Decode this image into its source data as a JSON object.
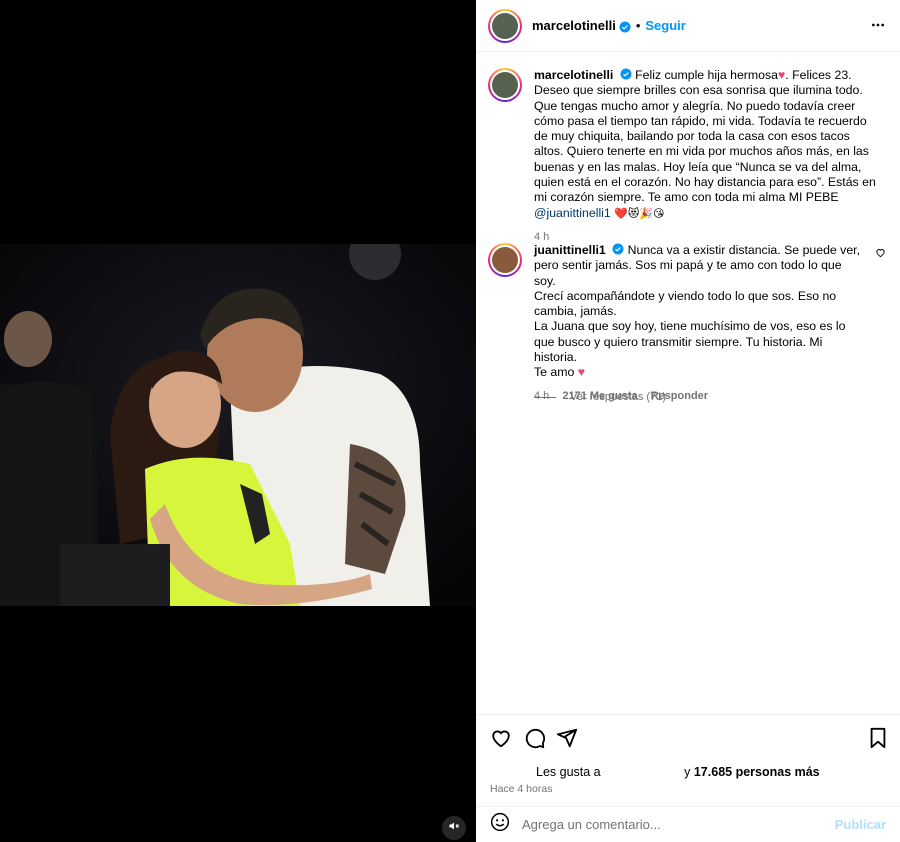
{
  "post": {
    "author": "marcelotinelli",
    "follow_label": "Seguir",
    "separator": "•"
  },
  "caption": {
    "username": "marcelotinelli",
    "text_1": "Feliz cumple hija hermosa",
    "text_2": ". Felices 23. Deseo que siempre brilles con esa sonrisa que ilumina todo. Que tengas mucho amor y alegría. No puedo todavía creer cómo pasa el tiempo tan rápido, mi vida. Todavía te recuerdo de muy chiquita, bailando por toda la casa con esos tacos altos. Quiero tenerte en mi vida por muchos años más, en las buenas y en las malas. Hoy leía que “Nunca se va del alma, quien está en el corazón. No hay distancia para eso”. Estás en mi corazón siempre. Te amo con toda mi alma MI PEBE",
    "mention": "@juanittinelli1",
    "emojis": "❤️😻🎉😘",
    "time": "4 h"
  },
  "reply": {
    "username": "juanittinelli1",
    "line_1": "Nunca va a existir distancia. Se puede ver, pero sentir jamás. Sos mi papá y te amo con todo lo que soy.",
    "line_2": "Crecí acompañándote y viendo todo lo que sos. Eso no cambia, jamás.",
    "line_3": "La Juana que soy hoy, tiene muchísimo de vos, eso es lo que busco y quiero transmitir siempre. Tu historia. Mi historia.",
    "line_4": "Te amo",
    "time": "4 h",
    "likes": "2171 Me gusta",
    "reply_label": "Responder",
    "view_replies": "Ver respuestas (71)"
  },
  "likes": {
    "prefix": "Les gusta a",
    "suffix_pre": "y",
    "count": "17.685 personas más"
  },
  "time_ago": "Hace 4 horas",
  "add_comment": {
    "placeholder": "Agrega un comentario...",
    "publish": "Publicar"
  },
  "colors": {
    "accent": "#0095f6",
    "verified": "#0095f6",
    "heart": "#e6447a",
    "shirt": "#d7f53a"
  }
}
